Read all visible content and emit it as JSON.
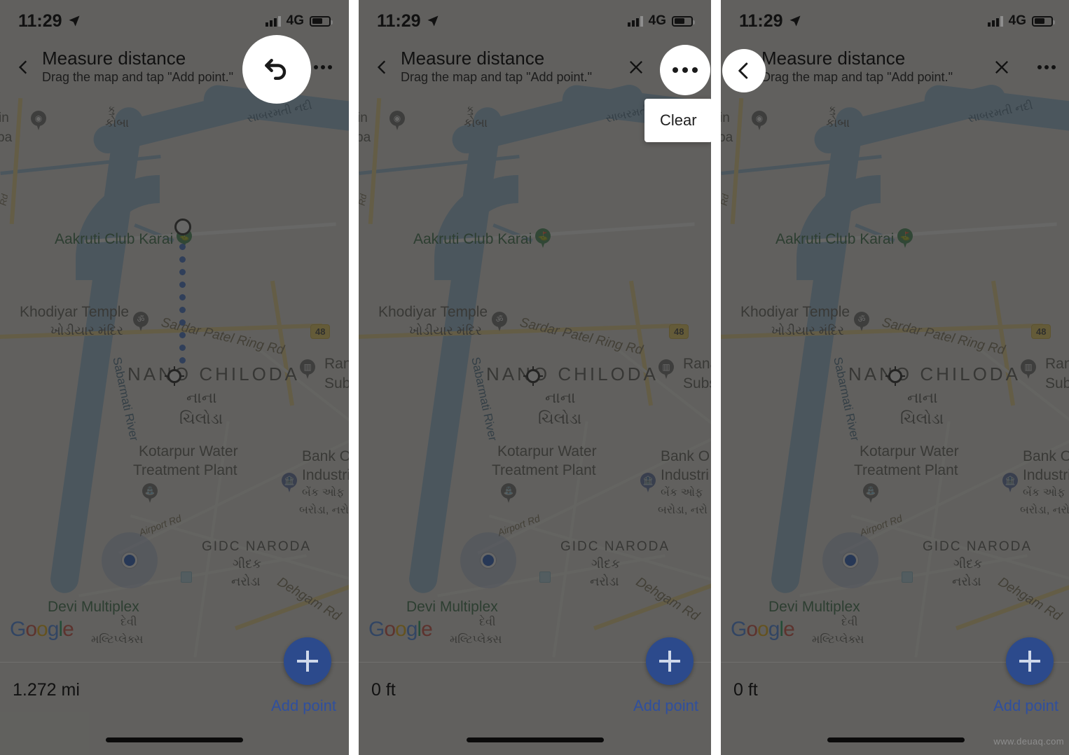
{
  "status_bar": {
    "time": "11:29",
    "location_icon": "location-arrow-icon",
    "signal_icon": "signal-bars-icon",
    "network": "4G",
    "battery_icon": "battery-icon"
  },
  "header": {
    "title": "Measure distance",
    "subtitle": "Drag the map and tap \"Add point.\"",
    "back_icon": "chevron-left-icon",
    "close_icon": "close-x-icon",
    "overflow_icon": "more-horizontal-icon",
    "undo_icon": "undo-arrow-icon"
  },
  "menu": {
    "items": [
      {
        "label": "Clear"
      }
    ]
  },
  "footer": {
    "add_point_label": "Add point",
    "fab_icon": "plus-icon",
    "distances": {
      "panel1": "1.272 mi",
      "panel2": "0 ft",
      "panel3": "0 ft"
    }
  },
  "panels": [
    {
      "id": "panel-1",
      "name": "measure-distance-with-line",
      "highlight": "undo-button",
      "distance": "1.272 mi",
      "shows_menu": false,
      "shows_close": false
    },
    {
      "id": "panel-2",
      "name": "overflow-menu-open",
      "highlight": "overflow-menu-button",
      "distance": "0 ft",
      "shows_menu": true,
      "shows_close": true
    },
    {
      "id": "panel-3",
      "name": "back-button-highlighted",
      "highlight": "back-button",
      "distance": "0 ft",
      "shows_menu": false,
      "shows_close": true
    }
  ],
  "map": {
    "attribution": "Google",
    "labels": {
      "aakruti": "Aakruti Club Karai",
      "khodiyar_en": "Khodiyar Temple",
      "khodiyar_gu": "ખોડીયાર મંદિર",
      "nano_chiloda_en": "NANO CHILODA",
      "nano_chiloda_gu1": "નાના",
      "nano_chiloda_gu2": "ચિલોડા",
      "kotarpur_l1": "Kotarpur Water",
      "kotarpur_l2": "Treatment Plant",
      "bank_l1": "Bank O",
      "bank_l2": "Industri",
      "bank_gu1": "બેંક ઓફ",
      "bank_gu2": "બરોડા, નરો",
      "gidc_en": "GIDC NARODA",
      "gidc_gu1": "ગીદક",
      "gidc_gu2": "નરોડા",
      "devi_en": "Devi Multiplex",
      "devi_gu1": "દેવી",
      "devi_gu2": "મલ્ટિપ્લેક્સ",
      "sardar_road": "Sardar Patel Ring Rd",
      "airport_road": "Airport Rd",
      "dehgam_road": "Dehgam Rd",
      "sabarmati_river": "Sabarmati River",
      "sabarmati_gu": "સાબરમતી નદી",
      "koba_gu": "કોબા",
      "koba_top": "કુ",
      "rana_l1": "Rana",
      "rana_l2": "Subs",
      "left_in": "in",
      "left_ba": "ba",
      "left_rd": "Rd",
      "highway_shield": "48"
    }
  },
  "watermark": "www.deuaq.com",
  "colors": {
    "map_bg": "#e8e6e1",
    "water": "#9cc0de",
    "highway": "#f3d98b",
    "measure_line": "#3b6fd4",
    "fab": "#2c4a8c",
    "add_point_text": "#2f4f9e",
    "poi_green": "#2f6b42",
    "dim_overlay": "rgba(45,45,43,0.72)"
  }
}
